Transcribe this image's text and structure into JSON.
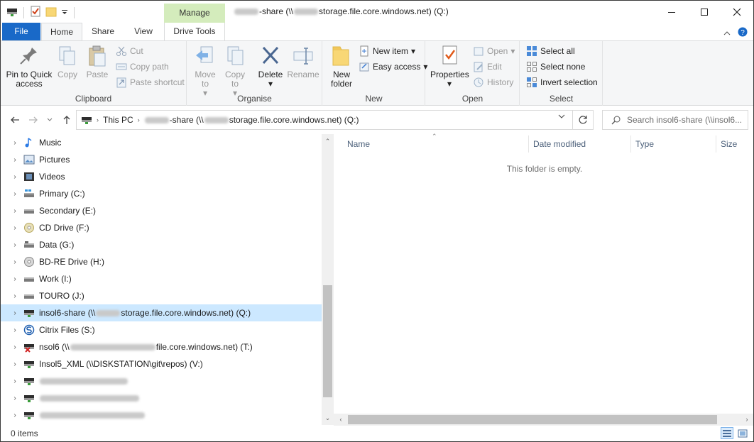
{
  "titlebar": {
    "contextual_tab": "Manage",
    "title_pre": "",
    "title_mid": "-share (\\\\",
    "title_post": "storage.file.core.windows.net) (Q:)"
  },
  "tabs": {
    "file": "File",
    "home": "Home",
    "share": "Share",
    "view": "View",
    "drive_tools": "Drive Tools"
  },
  "ribbon": {
    "clipboard": {
      "label": "Clipboard",
      "pin": "Pin to Quick access",
      "copy": "Copy",
      "paste": "Paste",
      "cut": "Cut",
      "copy_path": "Copy path",
      "paste_shortcut": "Paste shortcut"
    },
    "organise": {
      "label": "Organise",
      "move_to": "Move to",
      "copy_to": "Copy to",
      "delete": "Delete",
      "rename": "Rename"
    },
    "new": {
      "label": "New",
      "new_folder": "New folder",
      "new_item": "New item",
      "easy_access": "Easy access"
    },
    "open": {
      "label": "Open",
      "properties": "Properties",
      "open": "Open",
      "edit": "Edit",
      "history": "History"
    },
    "select": {
      "label": "Select",
      "select_all": "Select all",
      "select_none": "Select none",
      "invert": "Invert selection"
    }
  },
  "address": {
    "this_pc": "This PC",
    "crumb_mid": "-share (\\\\",
    "crumb_post": "storage.file.core.windows.net) (Q:)",
    "search_placeholder": "Search insol6-share (\\\\insol6..."
  },
  "nav": {
    "items": [
      {
        "label": "Music",
        "icon": "music-icon"
      },
      {
        "label": "Pictures",
        "icon": "pictures-icon"
      },
      {
        "label": "Videos",
        "icon": "videos-icon"
      },
      {
        "label": "Primary (C:)",
        "icon": "windows-drive-icon"
      },
      {
        "label": "Secondary (E:)",
        "icon": "drive-icon"
      },
      {
        "label": "CD Drive (F:)",
        "icon": "cd-drive-icon"
      },
      {
        "label": "Data (G:)",
        "icon": "drive-icon"
      },
      {
        "label": "BD-RE Drive (H:)",
        "icon": "bd-drive-icon"
      },
      {
        "label": "Work (I:)",
        "icon": "drive-icon"
      },
      {
        "label": "TOURO (J:)",
        "icon": "drive-icon"
      },
      {
        "label_pre": "insol6-share (\\\\",
        "label_post": "storage.file.core.windows.net) (Q:)",
        "icon": "network-drive-icon"
      },
      {
        "label": "Citrix Files (S:)",
        "icon": "citrix-icon"
      },
      {
        "label_pre": "nsol6 (\\\\",
        "label_post": "file.core.windows.net) (T:)",
        "icon": "network-drive-disconnected-icon"
      },
      {
        "label": "Insol5_XML (\\\\DISKSTATION\\git\\repos) (V:)",
        "icon": "network-drive-icon"
      }
    ]
  },
  "content": {
    "columns": [
      "Name",
      "Date modified",
      "Type",
      "Size"
    ],
    "empty_text": "This folder is empty."
  },
  "status": {
    "items": "0 items"
  }
}
